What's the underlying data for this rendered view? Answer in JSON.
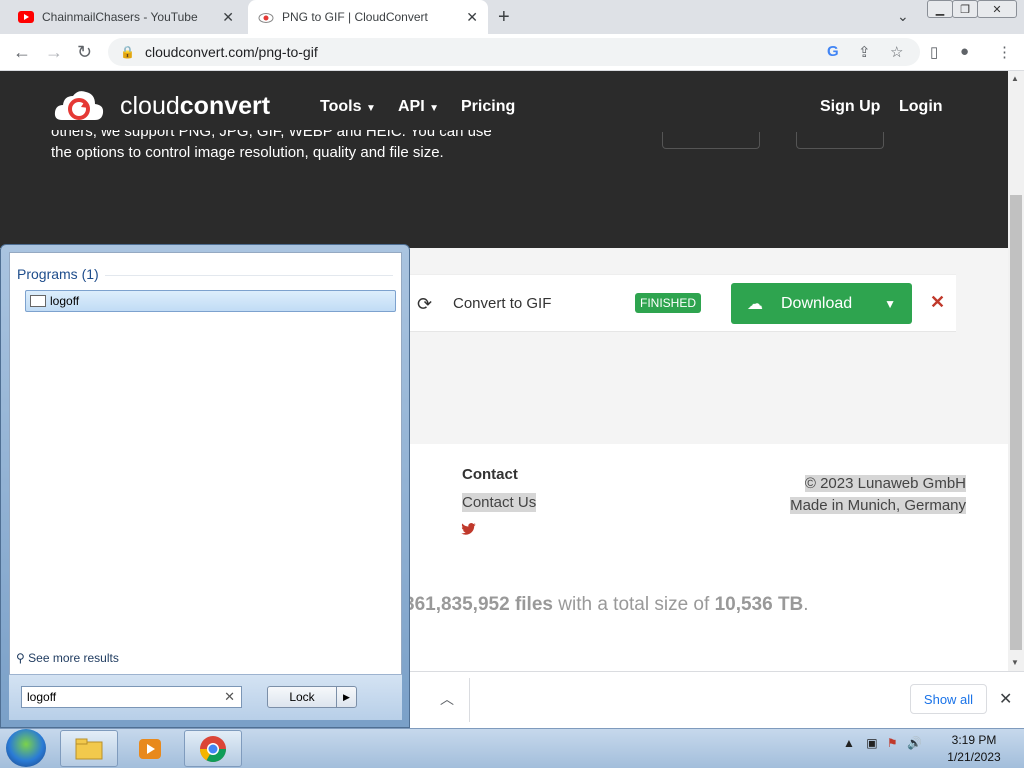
{
  "browser": {
    "tabs": [
      {
        "title": "ChainmailChasers - YouTube"
      },
      {
        "title": "PNG to GIF | CloudConvert"
      }
    ],
    "url": "cloudconvert.com/png-to-gif"
  },
  "site": {
    "brand_light": "cloud",
    "brand_bold": "convert",
    "nav": {
      "tools": "Tools",
      "api": "API",
      "pricing": "Pricing",
      "signup": "Sign Up",
      "login": "Login"
    },
    "hero_text_line1": "others, we support PNG, JPG, GIF, WEBP and HEIC. You can use",
    "hero_text_line2": "the options to control image resolution, quality and file size."
  },
  "conversion": {
    "label": "Convert to GIF",
    "status": "FINISHED",
    "download_label": "Download"
  },
  "footer": {
    "contact_heading": "Contact",
    "contact_link": "Contact Us",
    "copyright": "© 2023 Lunaweb GmbH",
    "location": "Made in Munich, Germany",
    "stats_files": "361,835,952 files",
    "stats_mid": "with a total size of",
    "stats_size": "10,536 TB",
    "stats_end": "."
  },
  "shelf": {
    "show_all": "Show all"
  },
  "start_menu": {
    "programs_heading": "Programs (1)",
    "program_item": "logoff",
    "see_more": "See more results",
    "search_value": "logoff",
    "lock_label": "Lock"
  },
  "taskbar": {
    "time": "3:19 PM",
    "date": "1/21/2023"
  }
}
